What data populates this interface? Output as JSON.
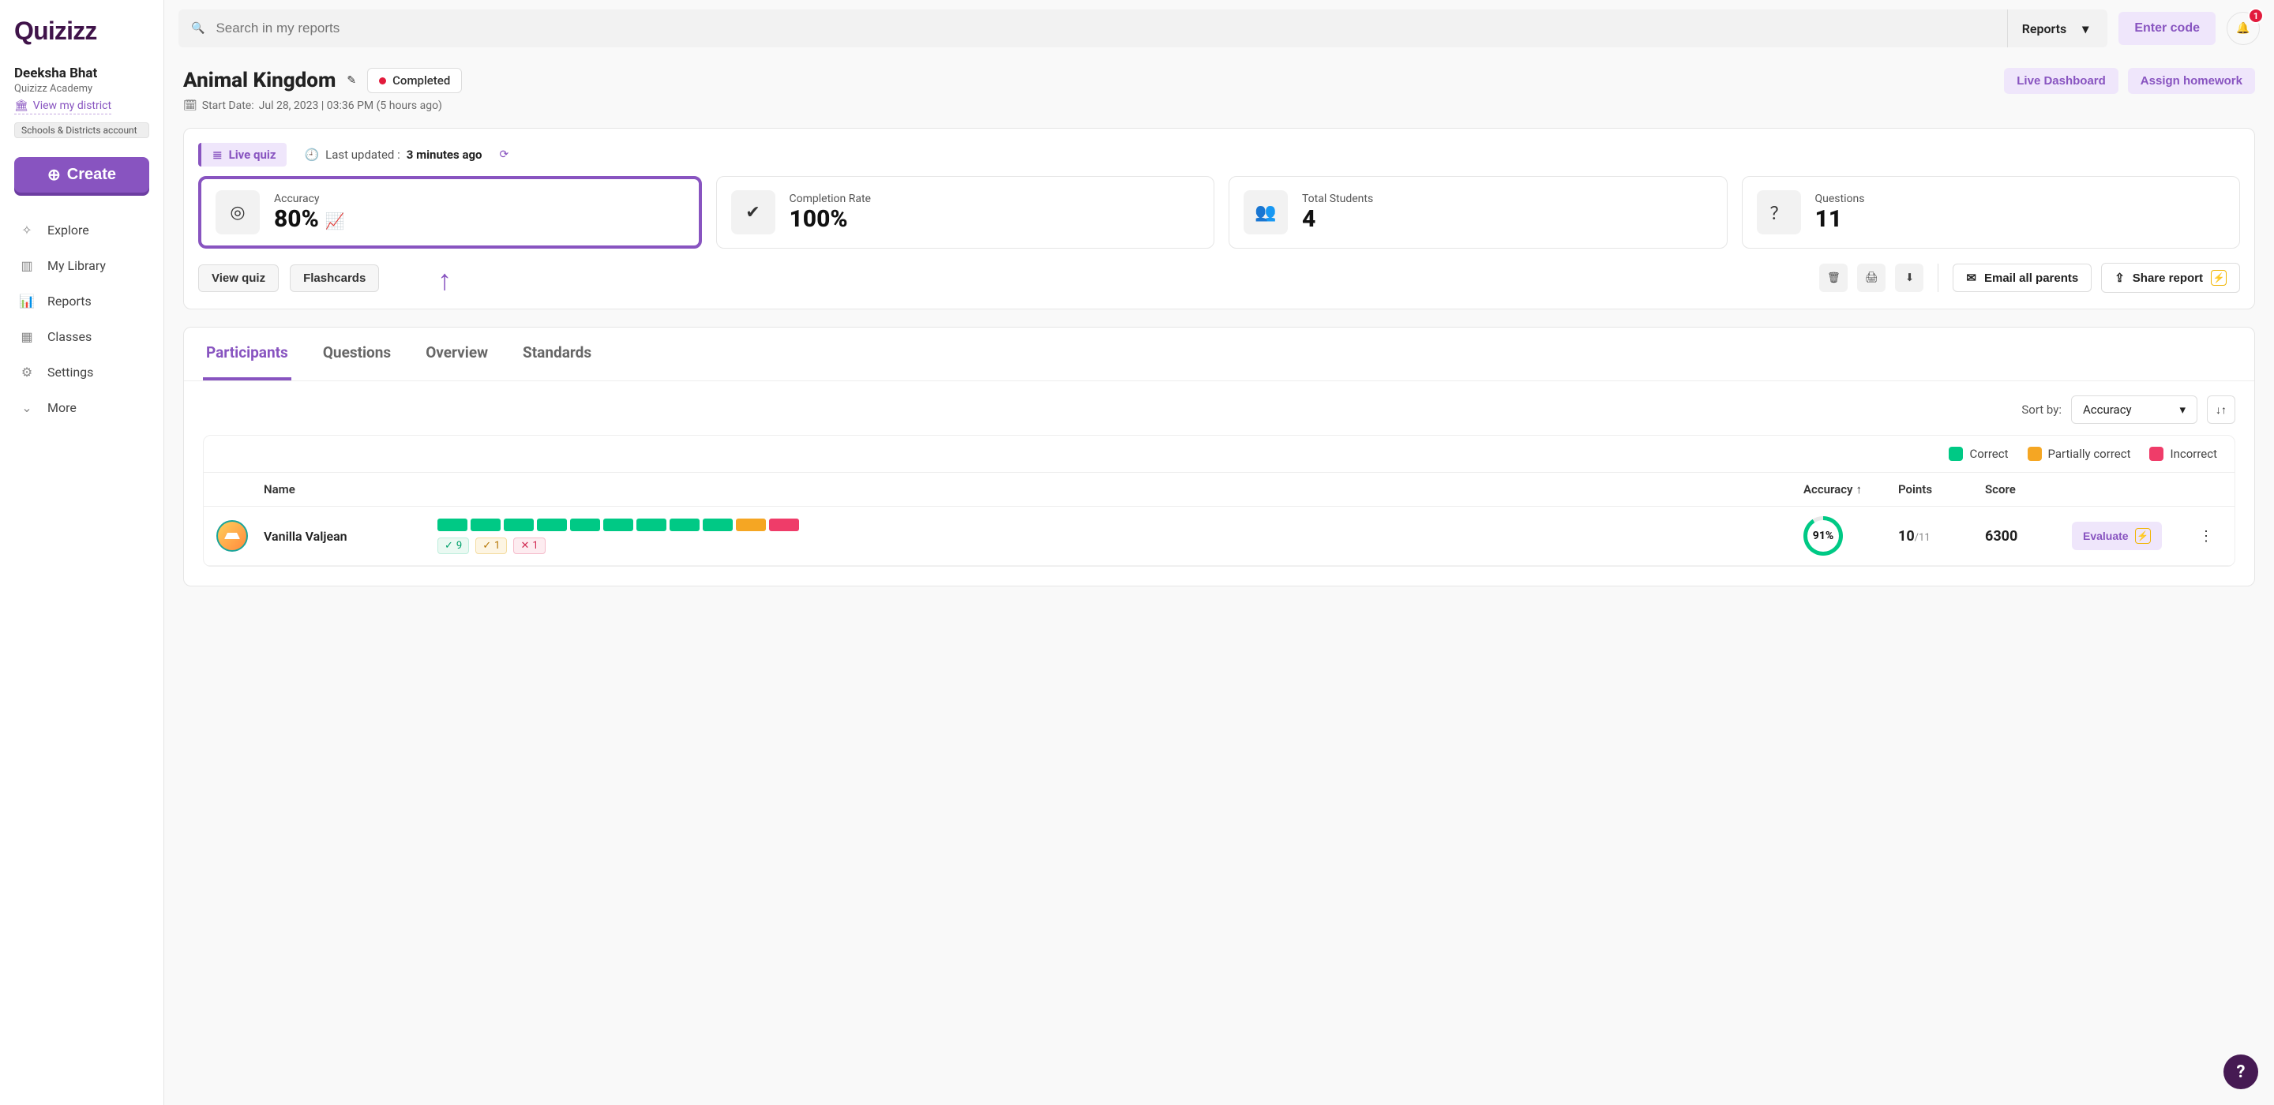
{
  "search": {
    "placeholder": "Search in my reports",
    "scope": "Reports"
  },
  "topbar": {
    "enter_code": "Enter code",
    "bell_count": "1"
  },
  "sidebar": {
    "user_name": "Deeksha Bhat",
    "user_sub": "Quizizz Academy",
    "view_district": "View my district",
    "account_tag": "Schools & Districts account",
    "create_label": "Create",
    "nav": [
      {
        "label": "Explore",
        "icon": "compass-icon"
      },
      {
        "label": "My Library",
        "icon": "library-icon"
      },
      {
        "label": "Reports",
        "icon": "chart-icon"
      },
      {
        "label": "Classes",
        "icon": "classes-icon"
      },
      {
        "label": "Settings",
        "icon": "gear-icon"
      },
      {
        "label": "More",
        "icon": "chevron-down-icon"
      }
    ]
  },
  "report": {
    "title": "Animal Kingdom",
    "status": "Completed",
    "start_label": "Start Date:",
    "start_value": "Jul 28, 2023 | 03:36 PM (5 hours ago)",
    "live_dashboard": "Live Dashboard",
    "assign_homework": "Assign homework"
  },
  "summary": {
    "live_quiz": "Live quiz",
    "updated_prefix": "Last updated :",
    "updated_value": "3 minutes ago",
    "stats": {
      "accuracy": {
        "label": "Accuracy",
        "value": "80%"
      },
      "completion": {
        "label": "Completion Rate",
        "value": "100%"
      },
      "students": {
        "label": "Total Students",
        "value": "4"
      },
      "questions": {
        "label": "Questions",
        "value": "11"
      }
    },
    "view_quiz": "View quiz",
    "flashcards": "Flashcards",
    "email_parents": "Email all parents",
    "share_report": "Share report"
  },
  "tabs": {
    "participants": "Participants",
    "questions": "Questions",
    "overview": "Overview",
    "standards": "Standards"
  },
  "table": {
    "sort_label": "Sort by:",
    "sort_value": "Accuracy",
    "legend": {
      "correct": "Correct",
      "partial": "Partially correct",
      "incorrect": "Incorrect"
    },
    "headers": {
      "name": "Name",
      "accuracy": "Accuracy",
      "points": "Points",
      "score": "Score"
    },
    "evaluate_label": "Evaluate",
    "rows": [
      {
        "name": "Vanilla Valjean",
        "segments": {
          "correct": 9,
          "partial": 1,
          "incorrect": 1
        },
        "pill_correct": "9",
        "pill_partial": "1",
        "pill_incorrect": "1",
        "accuracy": "91%",
        "points_got": "10",
        "points_total": "/11",
        "score": "6300"
      }
    ]
  }
}
